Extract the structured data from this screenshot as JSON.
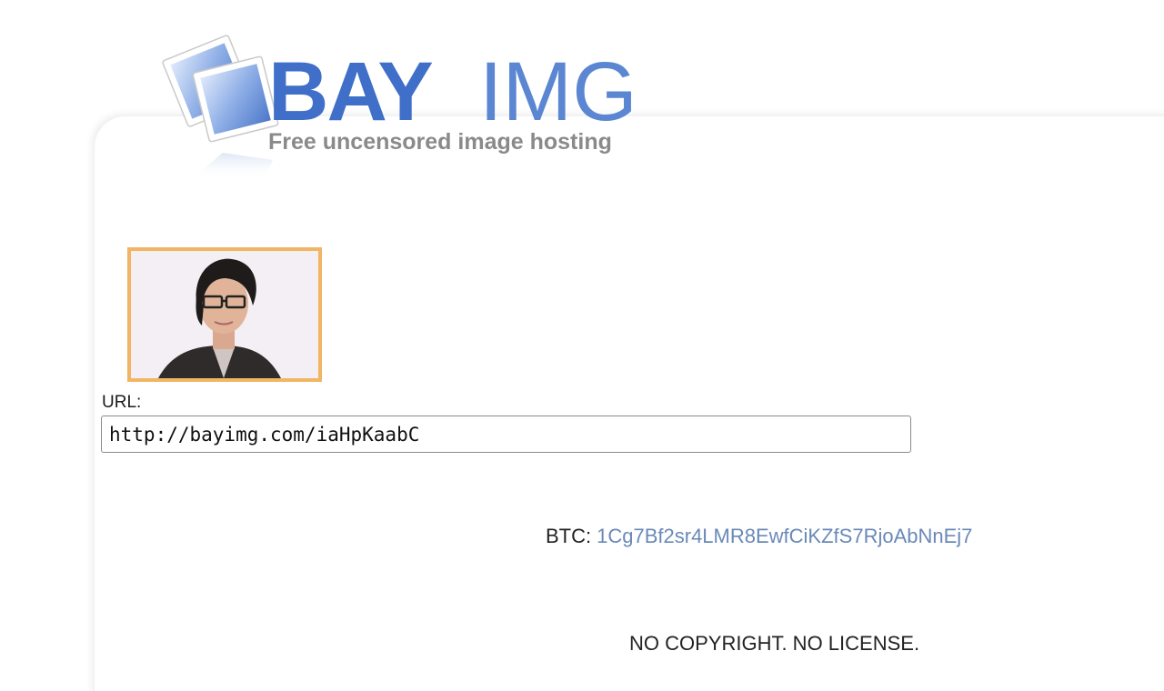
{
  "logo": {
    "brand_bold": "BAY",
    "brand_light": "IMG",
    "tagline": "Free uncensored image hosting",
    "colors": {
      "brand_blue": "#3f6fc8",
      "tagline_gray": "#8a8a8a"
    }
  },
  "image": {
    "thumbnail_icon": "portrait-photo",
    "frame_color": "#f1b564"
  },
  "url_field": {
    "label": "URL:",
    "value": "http://bayimg.com/iaHpKaabC"
  },
  "donation": {
    "label": "BTC:",
    "address": "1Cg7Bf2sr4LMR8EwfCiKZfS7RjoAbNnEj7",
    "link_color": "#6a89b8"
  },
  "footer": {
    "notice": "NO COPYRIGHT. NO LICENSE."
  }
}
